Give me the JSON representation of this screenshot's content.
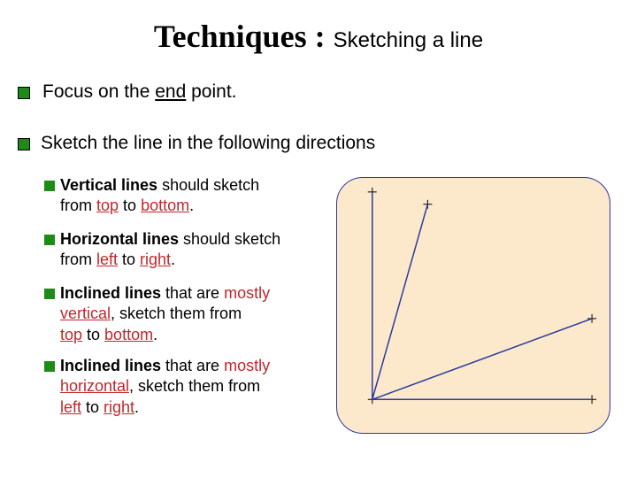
{
  "title": {
    "main": "Techniques : ",
    "sub": "Sketching a line"
  },
  "bullets": {
    "b1_pre": "Focus on the ",
    "b1_u": "end",
    "b1_post": " point.",
    "b2": "Sketch the line in the following directions"
  },
  "sub": {
    "v": {
      "t1": "Vertical lines",
      "t2": " should sketch",
      "t3": "from ",
      "top": "top",
      "mid": " to ",
      "bot": "bottom",
      "end": "."
    },
    "h": {
      "t1": "Horizontal lines",
      "t2": " should sketch",
      "t3": "from ",
      "l": "left",
      "mid": " to ",
      "r": "right",
      "end": "."
    },
    "iv": {
      "t1": "Inclined lines",
      "t2": " that are ",
      "mv": "mostly",
      "mv2": "vertical",
      "t3": ", sketch them from",
      "top": "top",
      "mid": " to ",
      "bot": "bottom",
      "end": "."
    },
    "ih": {
      "t1": "Inclined lines",
      "t2": " that are ",
      "mh": "mostly",
      "mh2": "horizontal",
      "t3": ", sketch them from",
      "l": "left",
      "mid": " to ",
      "r": "right",
      "end": "."
    }
  }
}
